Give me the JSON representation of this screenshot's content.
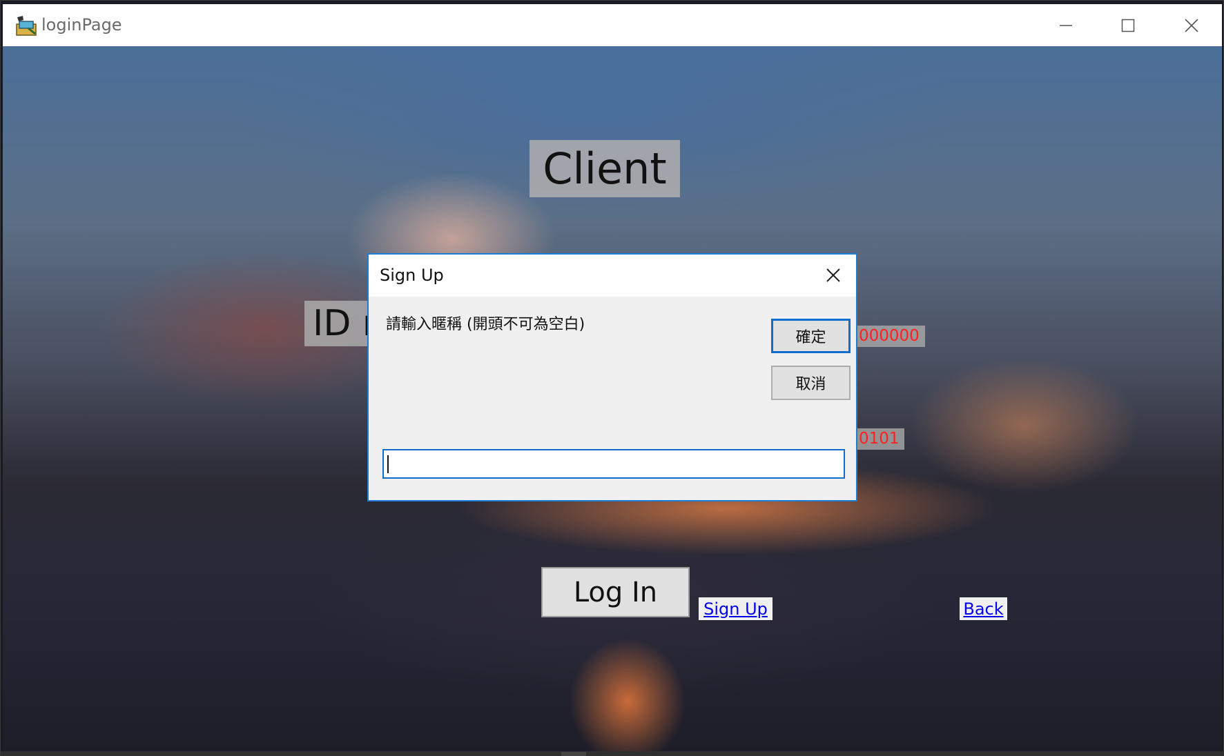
{
  "window": {
    "title": "loginPage",
    "controls": {
      "minimize": "minimize",
      "maximize": "maximize",
      "close": "close"
    }
  },
  "main": {
    "hero_title": "Client",
    "id_label": "ID r",
    "id_value_partial": "000000",
    "pw_value_partial": "0101",
    "login_button": "Log In",
    "signup_link": "Sign Up",
    "back_link": "Back"
  },
  "dialog": {
    "title": "Sign Up",
    "prompt": "請輸入暱稱 (開頭不可為空白)",
    "ok_button": "確定",
    "cancel_button": "取消",
    "input_value": ""
  },
  "colors": {
    "accent": "#0e6ecf",
    "link": "#0000ee",
    "error_text": "#ff2020"
  },
  "icons": {
    "app": "app-icon",
    "dialog_close": "close-icon"
  }
}
